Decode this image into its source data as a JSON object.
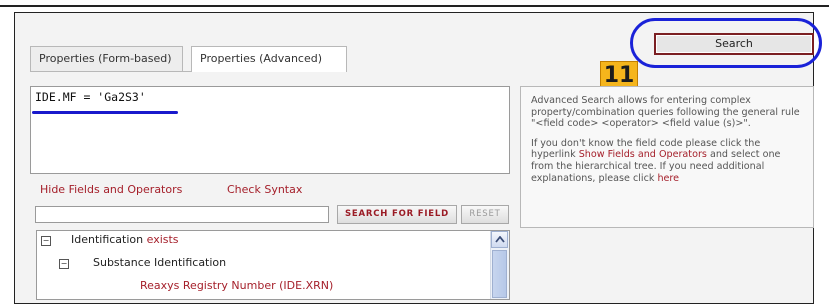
{
  "tabs": [
    {
      "label": "Properties (Form-based)"
    },
    {
      "label": "Properties (Advanced)"
    }
  ],
  "query": {
    "text": "IDE.MF = 'Ga2S3'"
  },
  "links": {
    "hide_fields": "Hide Fields and Operators",
    "check_syntax": "Check Syntax"
  },
  "field_search": {
    "value": "",
    "search_button": "SEARCH FOR FIELD",
    "reset_button": "RESET"
  },
  "tree": {
    "row1": {
      "label": "Identification",
      "status": "exists"
    },
    "row2": {
      "label": "Substance Identification"
    },
    "row3": {
      "label": "Reaxys Registry Number (IDE.XRN)"
    }
  },
  "search_button": {
    "label": "Search"
  },
  "step_badge": {
    "label": "11"
  },
  "help": {
    "p1": "Advanced Search allows for entering complex property/combination queries following the general rule \"<field code> <operator> <field value (s)>\".",
    "p2_pre": "If you don't know the field code please click the hyperlink ",
    "p2_link": "Show Fields and Operators",
    "p2_mid": " and select one from the hierarchical tree. If you need additional explanations, please click ",
    "p2_link2": "here"
  },
  "colors": {
    "highlight_oval": "#1a22d8",
    "link_red": "#a5202b",
    "badge": "#f5b51c"
  }
}
